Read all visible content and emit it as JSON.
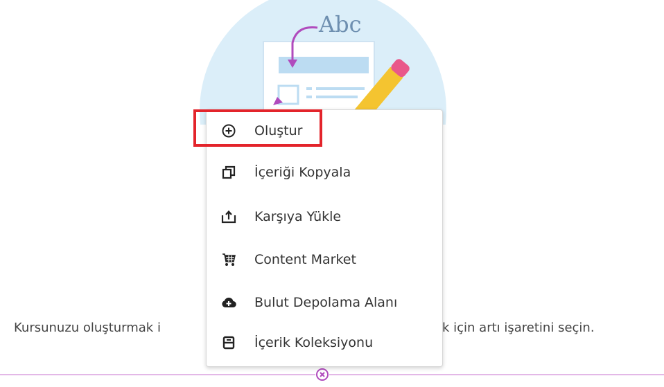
{
  "illustration": {
    "sample_text": "Abc"
  },
  "background_text": {
    "left_part": "Kursunuzu oluşturmak i",
    "right_part": "k için artı işaretini seçin."
  },
  "menu": {
    "items": [
      {
        "label": "Oluştur",
        "icon": "plus-circle-icon"
      },
      {
        "label": "İçeriği Kopyala",
        "icon": "copy-icon"
      },
      {
        "label": "Karşıya Yükle",
        "icon": "upload-icon"
      },
      {
        "label": "Content Market",
        "icon": "cart-icon"
      },
      {
        "label": "Bulut Depolama Alanı",
        "icon": "cloud-add-icon"
      },
      {
        "label": "İçerik Koleksiyonu",
        "icon": "collection-icon"
      }
    ]
  },
  "colors": {
    "highlight": "#e3242b",
    "divider": "#c060c8",
    "accent_purple": "#b04bbd"
  }
}
